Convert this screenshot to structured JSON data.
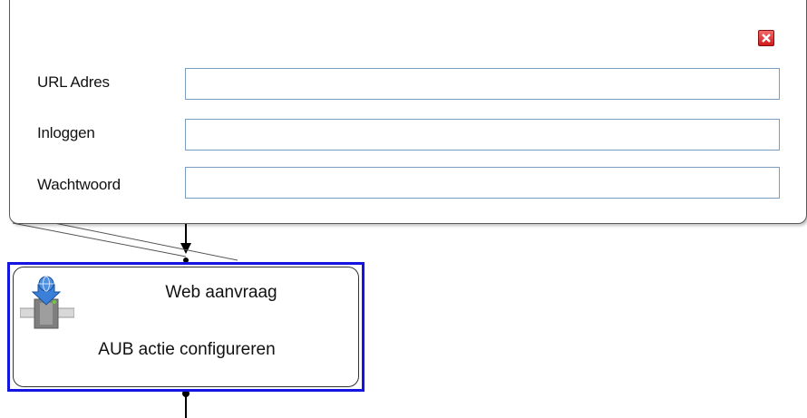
{
  "popup": {
    "fields": [
      {
        "label": "URL Adres",
        "value": ""
      },
      {
        "label": "Inloggen",
        "value": ""
      },
      {
        "label": "Wachtwoord",
        "value": ""
      }
    ],
    "close_icon": "close-x-icon"
  },
  "action_node": {
    "title": "Web aanvraag",
    "subtitle": "AUB actie configureren",
    "icon": "web-request-icon",
    "selected_border_color": "#1515e0"
  }
}
